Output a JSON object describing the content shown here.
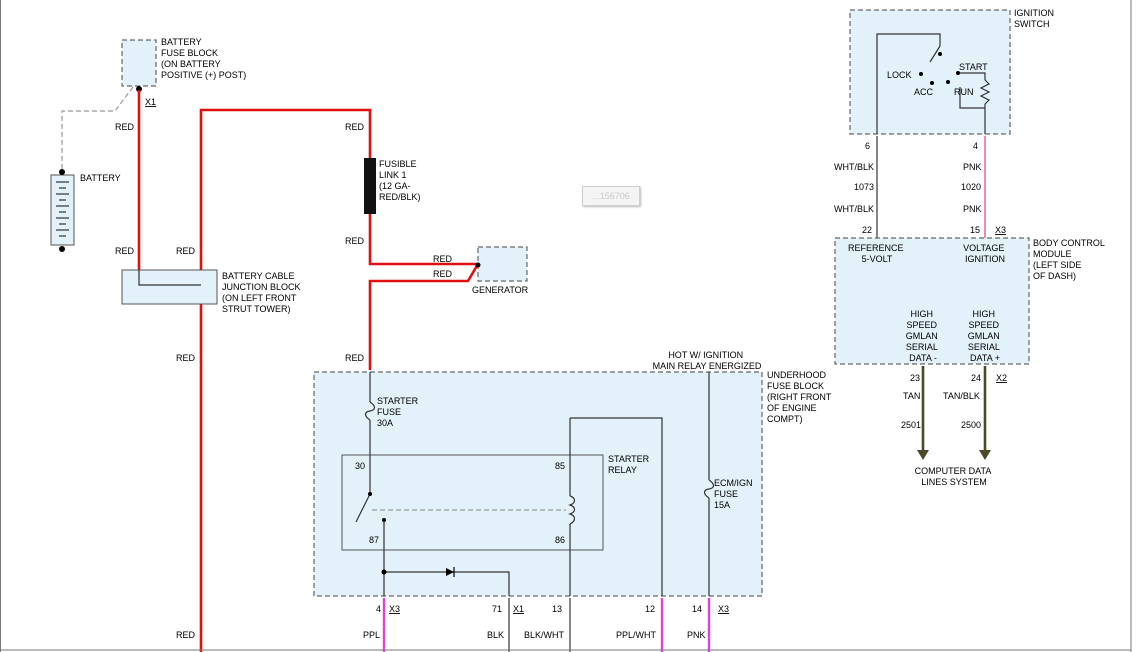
{
  "labels": {
    "battery_fuse_block": [
      "BATTERY",
      "FUSE BLOCK",
      "(ON BATTERY",
      "POSITIVE (+) POST)"
    ],
    "x1_top": "X1",
    "battery": "BATTERY",
    "junction_block": [
      "BATTERY CABLE",
      "JUNCTION BLOCK",
      "(ON LEFT FRONT",
      "STRUT TOWER)"
    ],
    "fusible_link": [
      "FUSIBLE",
      "LINK 1",
      "(12 GA-",
      "RED/BLK)"
    ],
    "generator": "GENERATOR",
    "hot_ignition": [
      "HOT W/ IGNITION",
      "MAIN RELAY ENERGIZED"
    ],
    "underhood": [
      "UNDERHOOD",
      "FUSE BLOCK",
      "(RIGHT FRONT",
      "OF ENGINE",
      "COMPT)"
    ],
    "starter_fuse": [
      "STARTER",
      "FUSE",
      "30A"
    ],
    "starter_relay": [
      "STARTER",
      "RELAY"
    ],
    "ecm_fuse": [
      "ECM/IGN",
      "FUSE",
      "15A"
    ],
    "pin30": "30",
    "pin85": "85",
    "pin87": "87",
    "pin86": "86",
    "ignition_switch": [
      "IGNITION",
      "SWITCH"
    ],
    "lock": "LOCK",
    "acc": "ACC",
    "start": "START",
    "run": "RUN",
    "pin6": "6",
    "pin4": "4",
    "bcm": [
      "BODY CONTROL",
      "MODULE",
      "(LEFT SIDE",
      "OF DASH)"
    ],
    "reference": [
      "REFERENCE",
      "5-VOLT"
    ],
    "voltage": [
      "VOLTAGE",
      "IGNITION"
    ],
    "gmlan_minus": [
      "HIGH",
      "SPEED",
      "GMLAN",
      "SERIAL",
      "DATA -"
    ],
    "gmlan_plus": [
      "HIGH",
      "SPEED",
      "GMLAN",
      "SERIAL",
      "DATA +"
    ],
    "pin22": "22",
    "pin15": "15",
    "x3_bcm": "X3",
    "pin23": "23",
    "pin24": "24",
    "x2": "X2",
    "computer_data": [
      "COMPUTER DATA",
      "LINES SYSTEM"
    ],
    "bottom_pins": {
      "p4": "4",
      "x3a": "X3",
      "p71": "71",
      "x1b": "X1",
      "p13": "13",
      "p12": "12",
      "p14": "14",
      "x3b": "X3"
    }
  },
  "wire_colors": {
    "red": "RED",
    "wht_blk": "WHT/BLK",
    "pnk": "PNK",
    "tan": "TAN",
    "tan_blk": "TAN/BLK",
    "ppl": "PPL",
    "blk": "BLK",
    "blk_wht": "BLK/WHT",
    "ppl_wht": "PPL/WHT"
  },
  "circuits": {
    "c1073": "1073",
    "c1020": "1020",
    "c2501": "2501",
    "c2500": "2500"
  },
  "watermark": "...156706",
  "colors": {
    "box_fill": "#e3f1fb",
    "red_wire": "#e01010",
    "pink_wire": "#f06aa0",
    "magenta_wire": "#e040e0",
    "data_wire": "#4a4a2a"
  }
}
